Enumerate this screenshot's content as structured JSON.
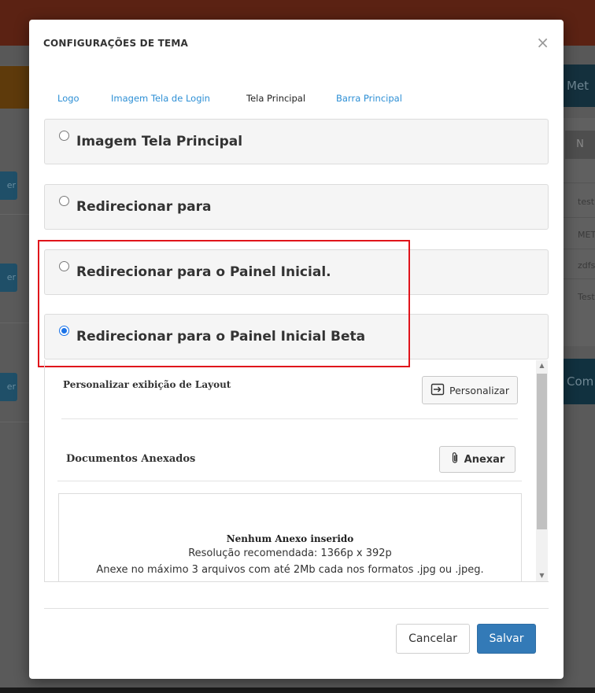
{
  "background": {
    "button_fragment": "er",
    "right_header_fragment": "Met",
    "right_n_fragment": "N",
    "right_rows": [
      "test",
      "MET",
      "zdfs",
      "Test"
    ],
    "right_com_fragment": "Com"
  },
  "modal": {
    "title": "CONFIGURAÇÕES DE TEMA",
    "close_symbol": "×",
    "tabs": [
      {
        "label": "Logo",
        "active": false
      },
      {
        "label": "Imagem Tela de Login",
        "active": false
      },
      {
        "label": "Tela Principal",
        "active": true
      },
      {
        "label": "Barra Principal",
        "active": false
      }
    ],
    "options": [
      {
        "label": "Imagem Tela Principal",
        "checked": false
      },
      {
        "label": "Redirecionar para",
        "checked": false
      },
      {
        "label": "Redirecionar para o Painel Inicial.",
        "checked": false
      },
      {
        "label": "Redirecionar para o Painel Inicial Beta",
        "checked": true
      }
    ],
    "layout": {
      "label": "Personalizar exibição de Layout",
      "button": "Personalizar"
    },
    "documents": {
      "label": "Documentos Anexados",
      "button": "Anexar",
      "empty_title": "Nenhum Anexo inserido",
      "resolution": "Resolução recomendada: 1366p x 392p",
      "limits": "Anexe no máximo 3 arquivos com até 2Mb cada nos formatos .jpg ou .jpeg."
    },
    "footer": {
      "cancel": "Cancelar",
      "save": "Salvar"
    }
  },
  "colors": {
    "accent": "#337ab7",
    "tab_link": "#2d8fd5",
    "highlight": "#e0141b",
    "radio_checked": "#1a73e8"
  },
  "icons": {
    "personalizar": "sign-in-icon",
    "anexar": "paperclip-icon"
  }
}
